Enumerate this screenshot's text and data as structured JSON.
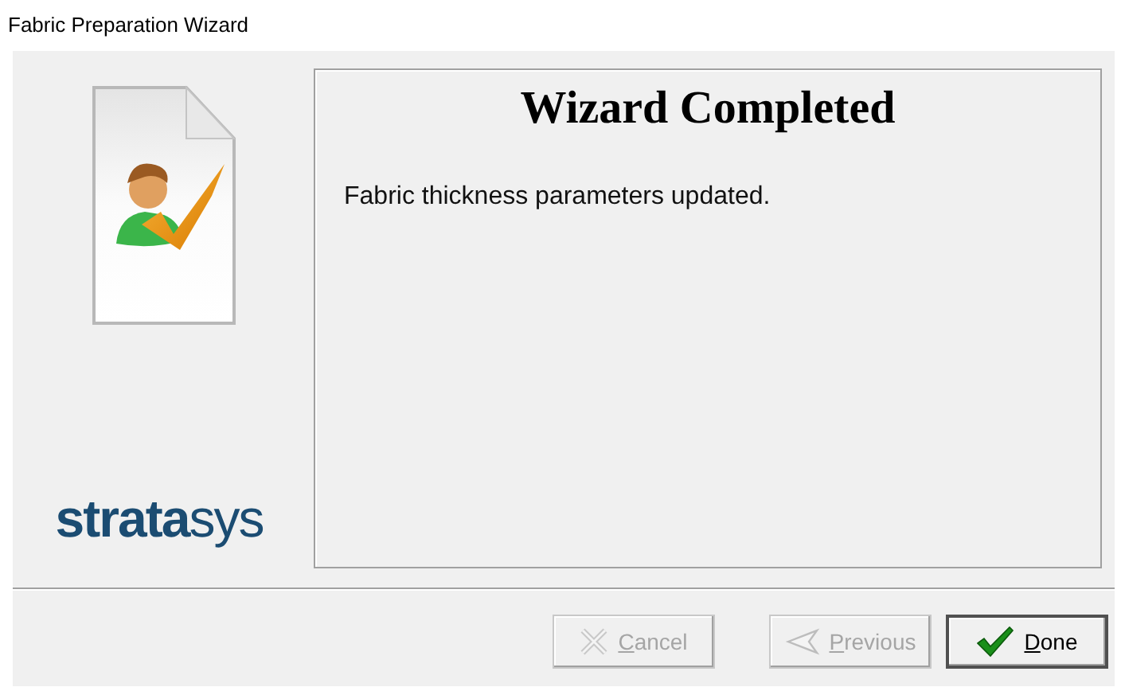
{
  "window": {
    "title": "Fabric Preparation Wizard"
  },
  "sidebar": {
    "logo": "**strata**sys"
  },
  "content": {
    "heading": "Wizard Completed",
    "message": "Fabric thickness parameters updated."
  },
  "buttons": [
    {
      "label": "Cancel",
      "kind": "cancel",
      "disabled": true,
      "default": false
    },
    {
      "label": "Previous",
      "kind": "previous",
      "disabled": true,
      "default": false
    },
    {
      "label": "Done",
      "kind": "done",
      "disabled": false,
      "default": true
    }
  ]
}
